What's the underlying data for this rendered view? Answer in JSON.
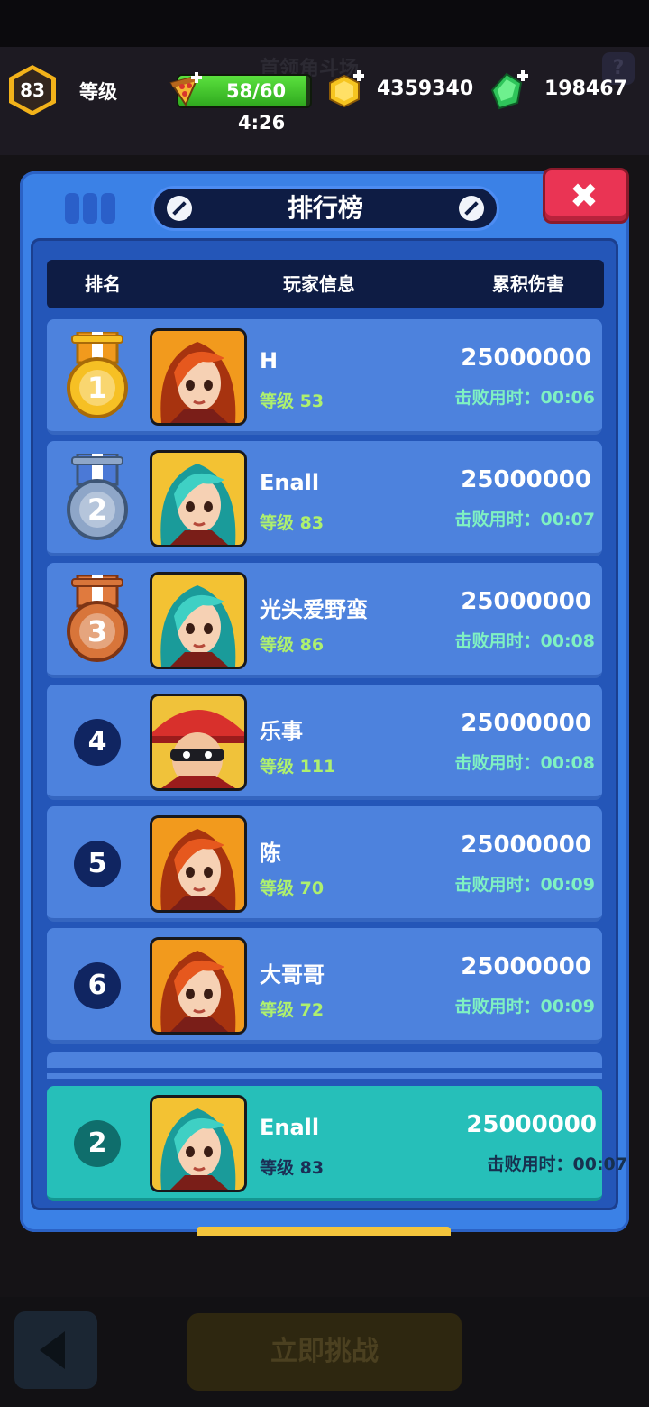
{
  "background": {
    "ghost_title": "首领角斗场",
    "help_label": "?",
    "challenge_button": "立即挑战"
  },
  "topbar": {
    "player_level": "83",
    "level_label": "等级",
    "stamina": "58/60",
    "stamina_fraction": 0.967,
    "stamina_timer": "4:26",
    "coins": "4359340",
    "gems": "198467"
  },
  "leaderboard": {
    "title": "排行榜",
    "close_label": "✖",
    "headers": {
      "rank": "排名",
      "player": "玩家信息",
      "damage": "累积伤害"
    },
    "rows": [
      {
        "rank": "1",
        "name": "H",
        "level": "等级 53",
        "damage": "25000000",
        "time": "击败用时：00:06",
        "avatar": "orange-hair-heroine"
      },
      {
        "rank": "2",
        "name": "Enall",
        "level": "等级 83",
        "damage": "25000000",
        "time": "击败用时：00:07",
        "avatar": "teal-hair-heroine"
      },
      {
        "rank": "3",
        "name": "光头爱野蛮",
        "level": "等级 86",
        "damage": "25000000",
        "time": "击败用时：00:08",
        "avatar": "teal-hair-heroine"
      },
      {
        "rank": "4",
        "name": "乐事",
        "level": "等级 111",
        "damage": "25000000",
        "time": "击败用时：00:08",
        "avatar": "red-hat-masked-hero"
      },
      {
        "rank": "5",
        "name": "陈",
        "level": "等级 70",
        "damage": "25000000",
        "time": "击败用时：00:09",
        "avatar": "orange-hair-heroine"
      },
      {
        "rank": "6",
        "name": "大哥哥",
        "level": "等级 72",
        "damage": "25000000",
        "time": "击败用时：00:09",
        "avatar": "orange-hair-heroine"
      }
    ],
    "my_entry": {
      "rank": "2",
      "name": "Enall",
      "level": "等级 83",
      "damage": "25000000",
      "time": "击败用时：00:07",
      "avatar": "teal-hair-heroine"
    }
  },
  "colors": {
    "panel": "#3b81e6",
    "row": "#4d82dd",
    "my_row": "#26bfb9",
    "gold": "#f2b21a",
    "close": "#ea3454"
  }
}
